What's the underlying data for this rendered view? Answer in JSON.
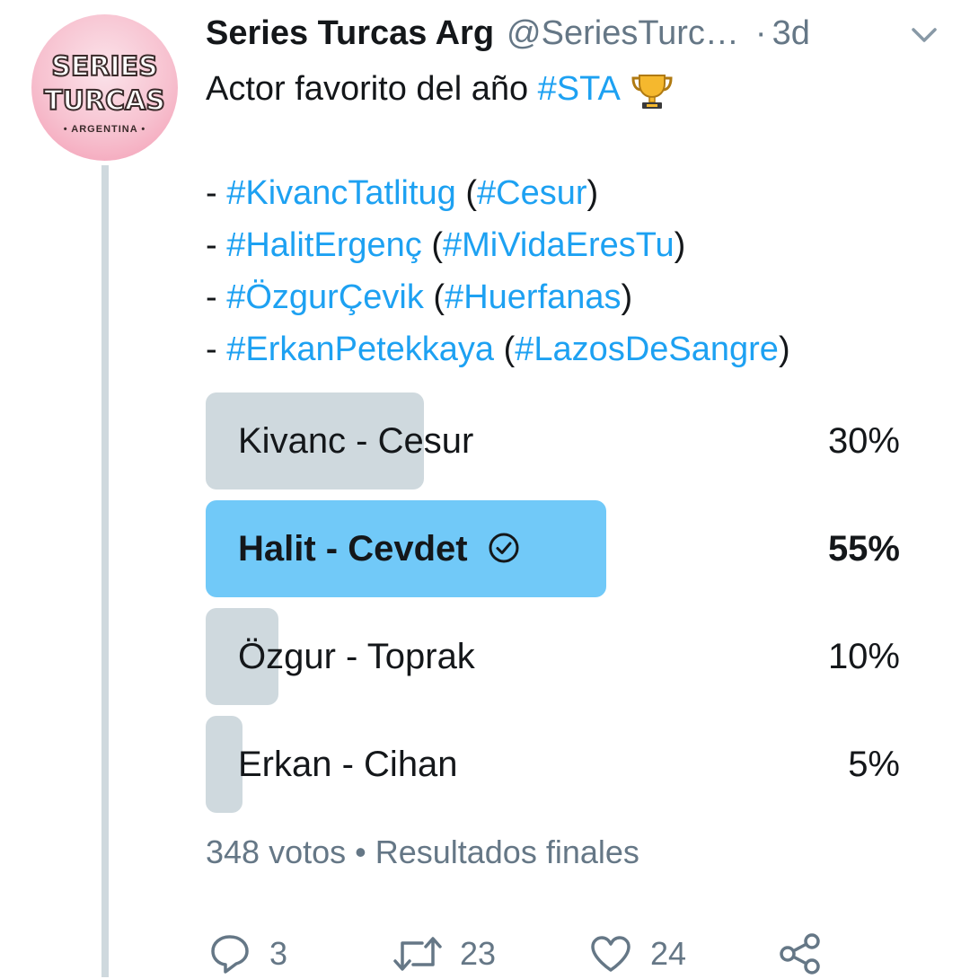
{
  "author": {
    "name": "Series Turcas Arg",
    "handle": "@SeriesTurc…",
    "separator": "·",
    "time": "3d",
    "avatar_logo": [
      "SERIES",
      "TURCAS",
      "• ARGENTINA •"
    ]
  },
  "tweet": {
    "line1": {
      "text": "Actor favorito del año ",
      "tag": "#STA"
    },
    "items": [
      {
        "dash": "- ",
        "tag1": "#KivancTatlitug",
        "open": " (",
        "tag2": "#Cesur",
        "close": ")"
      },
      {
        "dash": "- ",
        "tag1": "#HalitErgenç",
        "open": " (",
        "tag2": "#MiVidaEresTu",
        "close": ")"
      },
      {
        "dash": "- ",
        "tag1": "#ÖzgurÇevik",
        "open": " (",
        "tag2": "#Huerfanas",
        "close": ")"
      },
      {
        "dash": "- ",
        "tag1": "#ErkanPetekkaya",
        "open": " (",
        "tag2": "#LazosDeSangre",
        "close": ")"
      }
    ]
  },
  "poll": {
    "options": [
      {
        "label": "Kivanc - Cesur",
        "percent": "30%",
        "share": 0.3,
        "winner": false
      },
      {
        "label": "Halit - Cevdet",
        "percent": "55%",
        "share": 0.55,
        "winner": true
      },
      {
        "label": "Özgur - Toprak",
        "percent": "10%",
        "share": 0.1,
        "winner": false
      },
      {
        "label": "Erkan - Cihan",
        "percent": "5%",
        "share": 0.05,
        "winner": false
      }
    ],
    "meta": "348 votos • Resultados finales"
  },
  "actions": {
    "reply_count": "3",
    "retweet_count": "23",
    "like_count": "24"
  },
  "colors": {
    "link": "#1da1f2",
    "winner_bar": "#71c9f8",
    "bar": "#cfd9de",
    "muted": "#657786"
  }
}
